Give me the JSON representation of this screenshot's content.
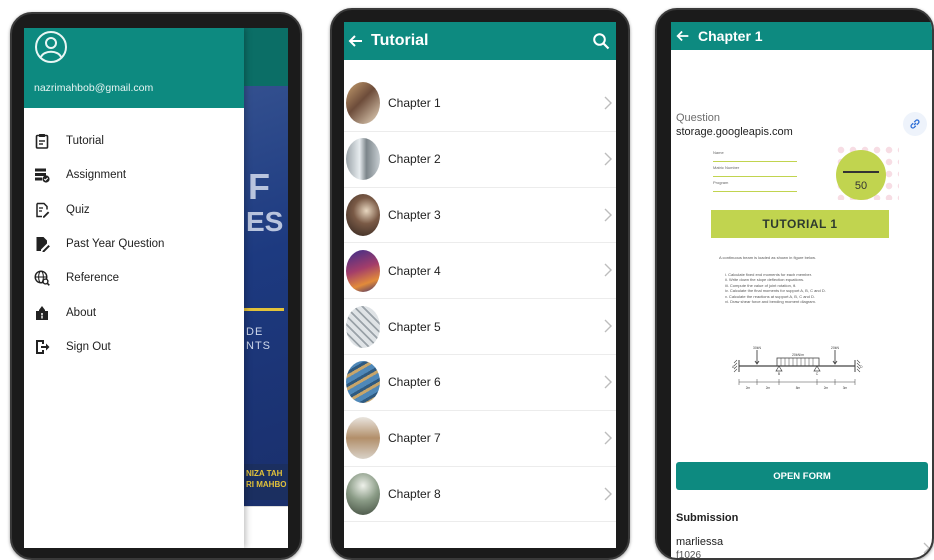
{
  "colors": {
    "teal": "#0d8a80",
    "lime": "#c1d44f",
    "navy": "#1f3c88"
  },
  "drawer": {
    "email": "nazrimahbob@gmail.com",
    "items": [
      {
        "label": "Tutorial",
        "icon": "clipboard-icon"
      },
      {
        "label": "Assignment",
        "icon": "list-check-icon"
      },
      {
        "label": "Quiz",
        "icon": "edit-note-icon"
      },
      {
        "label": "Past Year Question",
        "icon": "document-pencil-icon"
      },
      {
        "label": "Reference",
        "icon": "globe-search-icon"
      },
      {
        "label": "About",
        "icon": "upload-info-icon"
      },
      {
        "label": "Sign Out",
        "icon": "sign-out-icon"
      }
    ],
    "background": {
      "big_letter": "F",
      "big_word": "ES",
      "line1": "DE",
      "line2": "NTS",
      "names_line1": "NIZA TAH",
      "names_line2": "RI MAHBO"
    }
  },
  "list": {
    "title": "Tutorial",
    "chapters": [
      "Chapter 1",
      "Chapter 2",
      "Chapter 3",
      "Chapter 4",
      "Chapter 5",
      "Chapter 6",
      "Chapter 7",
      "Chapter 8"
    ]
  },
  "detail": {
    "title": "Chapter 1",
    "question_label": "Question",
    "question_value": "storage.googleapis.com",
    "doc": {
      "field_name": "Name",
      "field_matric": "Matric Number",
      "field_program": "Program",
      "score": "50",
      "banner": "TUTORIAL 1",
      "intro": "A continuous beam is loaded as shown in figure below.",
      "steps": [
        "i.   Calculate fixed end moments for each member.",
        "ii.  Write down the slope deflection equations.",
        "iii. Compute the value of joint rotation, θ.",
        "iv.  Calculate the final moments for support A, B, C and D.",
        "v.   Calculate the reactions at support A, B, C and D.",
        "vi.  Draw shear force and bending moment diagram."
      ],
      "load_left": "30kN",
      "load_udl": "20kN/m",
      "load_right": "20kN",
      "support_a": "A",
      "support_b": "B",
      "support_c": "C",
      "support_d": "D",
      "span_dims": [
        "2m",
        "2m",
        "8m",
        "2m",
        "3m"
      ]
    },
    "open_form_label": "OPEN FORM",
    "submission_label": "Submission",
    "submission_user": "marliessa",
    "submission_code": "f1026"
  }
}
